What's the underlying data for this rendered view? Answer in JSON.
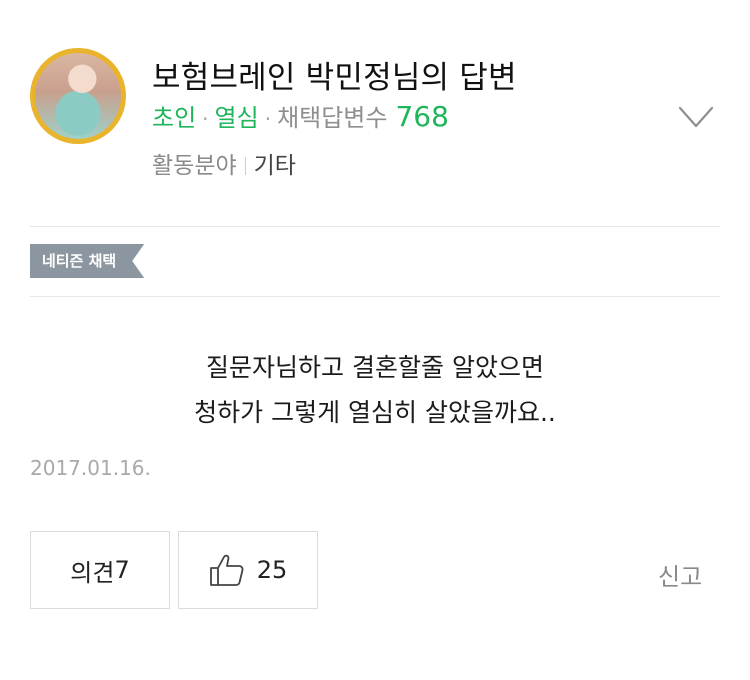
{
  "answerer": {
    "title": "보험브레인 박민정님의 답변",
    "rank": "초인",
    "status": "열심",
    "selected_count_label": "채택답변수",
    "selected_count": "768",
    "field_label": "활동분야",
    "field_value": "기타"
  },
  "badge": {
    "label": "네티즌 채택"
  },
  "answer": {
    "lines": [
      "질문자님하고 결혼할줄 알았으면",
      "청하가 그렇게 열심히 살았을까요.."
    ],
    "date": "2017.01.16."
  },
  "actions": {
    "opinion_label": "의견",
    "opinion_count": "7",
    "like_count": "25",
    "report_label": "신고"
  },
  "colors": {
    "accent_green": "#1fb55a",
    "badge_gray": "#8c96a0",
    "avatar_ring": "#e9b42c"
  },
  "icons": [
    "avatar",
    "chevron-down-icon",
    "thumbs-up-icon"
  ]
}
